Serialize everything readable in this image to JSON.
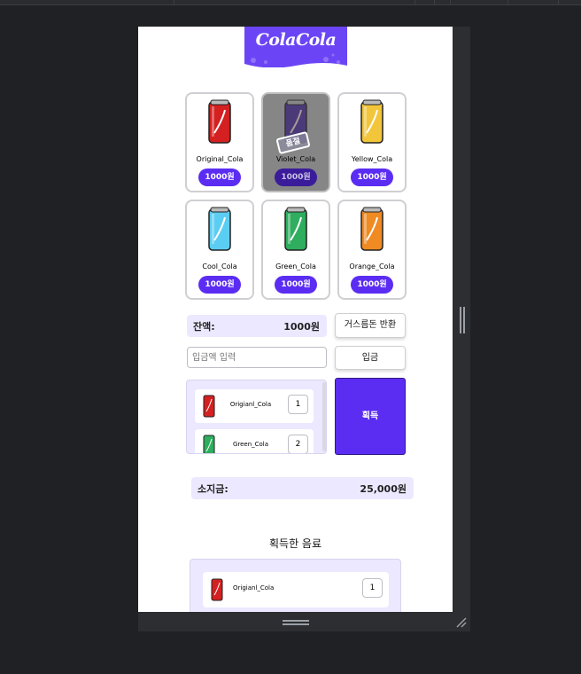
{
  "app": {
    "logo_text": "ColaCola",
    "brand_color": "#5b2df3",
    "accent_bg": "#ece8ff"
  },
  "colas": [
    {
      "name": "Original_Cola",
      "price": "1000원",
      "color": "#d42020",
      "sold_out": false
    },
    {
      "name": "Violet_Cola",
      "price": "1000원",
      "color": "#6a3fd0",
      "sold_out": true,
      "badge": "품절"
    },
    {
      "name": "Yellow_Cola",
      "price": "1000원",
      "color": "#f3c53a",
      "sold_out": false
    },
    {
      "name": "Cool_Cola",
      "price": "1000원",
      "color": "#5ccdf2",
      "sold_out": false
    },
    {
      "name": "Green_Cola",
      "price": "1000원",
      "color": "#2eae5e",
      "sold_out": false
    },
    {
      "name": "Orange_Cola",
      "price": "1000원",
      "color": "#f08a22",
      "sold_out": false
    }
  ],
  "balance": {
    "label": "잔액:",
    "value": "1000원"
  },
  "change_button": "거스름돈 반환",
  "deposit": {
    "placeholder": "입금액 입력",
    "button": "입금"
  },
  "cart": {
    "items": [
      {
        "name": "Origianl_Cola",
        "qty": "1",
        "color": "#d42020"
      },
      {
        "name": "Green_Cola",
        "qty": "2",
        "color": "#2eae5e"
      }
    ]
  },
  "get_button": "획득",
  "wallet": {
    "label": "소지금:",
    "value": "25,000원"
  },
  "acquired": {
    "title": "획득한 음료",
    "items": [
      {
        "name": "Origianl_Cola",
        "qty": "1",
        "color": "#d42020"
      }
    ]
  },
  "icons": {
    "can": "cola-can-icon",
    "soldout": "soldout-stamp-icon",
    "resize": "resize-handle-icon"
  }
}
